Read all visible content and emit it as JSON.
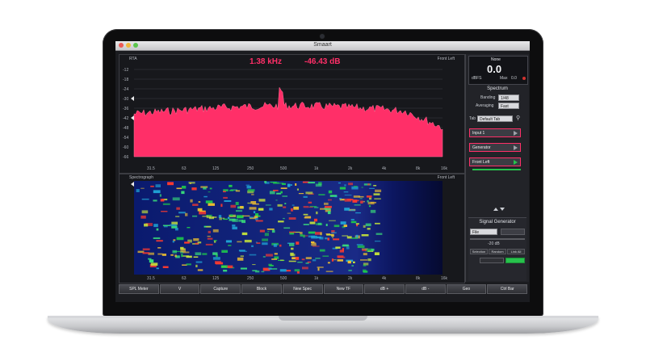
{
  "window": {
    "title": "Smaart"
  },
  "readout": {
    "frequency": "1.38 kHz",
    "level": "-46.43 dB"
  },
  "spectrum": {
    "label": "RTA",
    "channel_label": "Front Left",
    "db_ticks": [
      "-12",
      "-18",
      "-24",
      "-30",
      "-36",
      "-42",
      "-48",
      "-54",
      "-60",
      "-66"
    ],
    "freq_ticks": [
      "31.5",
      "63",
      "125",
      "250",
      "500",
      "1k",
      "2k",
      "4k",
      "8k",
      "16k"
    ],
    "color": "#ff2f68"
  },
  "spectrograph": {
    "label": "Spectrograph",
    "channel_label": "Front Left",
    "freq_ticks": [
      "31.5",
      "63",
      "125",
      "250",
      "500",
      "1k",
      "2k",
      "4k",
      "8k",
      "16k"
    ]
  },
  "sidebar": {
    "meter": {
      "label": "None",
      "value": "0.0",
      "unit": "dBFS",
      "max_label": "Max",
      "max_value": "0.0"
    },
    "spectrum_section": {
      "heading": "Spectrum",
      "banding_label": "Banding",
      "banding_value": "1/48",
      "averaging_label": "Averaging",
      "averaging_value": "Fast",
      "tab_label": "Tab",
      "tab_value": "Default Tab"
    },
    "routes": [
      {
        "label": "Input 1"
      },
      {
        "label": "Generator"
      },
      {
        "label": "Front Left"
      }
    ],
    "generator": {
      "heading": "Signal Generator",
      "type_value": "File",
      "level_value": "-20 dB",
      "buttons": [
        "Selection",
        "Random",
        "Link All"
      ]
    }
  },
  "bottom_bar": {
    "buttons": [
      "SPL Meter",
      "V",
      "Capture",
      "Block",
      "New Spec",
      "New TF",
      "dB +",
      "dB -",
      "Geo",
      "Ctrl Bar"
    ]
  },
  "colors": {
    "accent": "#ff2f68",
    "generator_on": "#27c24c"
  }
}
